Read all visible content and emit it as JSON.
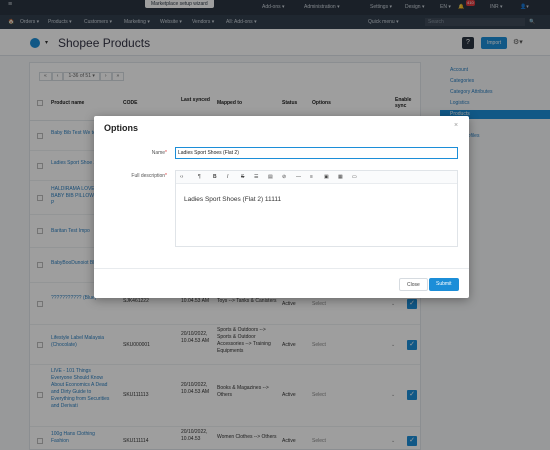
{
  "topbar": {
    "wizard": "Marketplace setup wizard",
    "items": [
      "Add-ons ▾",
      "Administration ▾",
      "Settings ▾",
      "Design ▾",
      "EN ▾",
      "INR ▾"
    ],
    "badge": "410"
  },
  "navbar": {
    "items": [
      "Orders ▾",
      "Products ▾",
      "Customers ▾",
      "Marketing ▾",
      "Website ▾",
      "Vendors ▾",
      "All: Add-ons ▾"
    ],
    "quick_menu": "Quick menu ▾",
    "search_placeholder": "Search"
  },
  "page": {
    "title": "Shopee Products",
    "import_label": "Import"
  },
  "pager": {
    "first": "«",
    "prev": "‹",
    "range": "1-36 of 51 ▾",
    "next": "›",
    "last": "»"
  },
  "table": {
    "headers": {
      "name": "Product name",
      "code": "CODE",
      "last_synced": "Last synced",
      "mapped_to": "Mapped to",
      "status": "Status",
      "options": "Options",
      "enable_sync": "Enable sync"
    },
    "rows": [
      {
        "name": "Baby Bib Test We test",
        "code": "",
        "last": "",
        "mapped": "",
        "status": "",
        "select": ""
      },
      {
        "name": "Ladies Sport Shoe 2)",
        "code": "",
        "last": "",
        "mapped": "",
        "status": "",
        "select": ""
      },
      {
        "name": "HALDIRAMA LOVE SHAPE BABY BIB PILLOW (BABY) P",
        "code": "",
        "last": "",
        "mapped": "",
        "status": "",
        "select": ""
      },
      {
        "name": "Baritan Test Impo",
        "code": "",
        "last": "",
        "mapped": "",
        "status": "",
        "select": ""
      },
      {
        "name": "BabyBooDunoiot Blue)",
        "code": "",
        "last": "",
        "mapped": "",
        "status": "",
        "select": ""
      },
      {
        "name": "??????????? (Blue)",
        "code": "SJK461222",
        "last": "10.04.53 AM",
        "mapped": "Toys --> Tanks & Canisters",
        "status": "Active",
        "select": "Select"
      },
      {
        "name": "Lifestyle Label Malaysia (Chocolate)",
        "code": "SKU000001",
        "last": "20/10/2022, 10.04.53 AM",
        "mapped": "Sports & Outdoors --> Sports & Outdoor Accessories --> Training Equipments",
        "status": "Active",
        "select": "Select"
      },
      {
        "name": "LIVE - 101 Things Everyone Should Know About Economics A Dead and Dirty Guide to Everything from Securities and Derivati",
        "code": "SKU111113",
        "last": "20/10/2022, 10.04.53 AM",
        "mapped": "Books & Magazines --> Others",
        "status": "Active",
        "select": "Select"
      },
      {
        "name": "100g Hans Clothing Fashion",
        "code": "SKU111114",
        "last": "20/10/2022, 10.04.53",
        "mapped": "Women Clothes --> Others",
        "status": "Active",
        "select": "Select"
      }
    ]
  },
  "sidebar": {
    "items": [
      "Account",
      "Categories",
      "Category Attributes",
      "Logistics",
      "Products",
      "Orders",
      "Price Profiles"
    ],
    "active_index": 4
  },
  "modal": {
    "title": "Options",
    "name_label": "Name",
    "name_value": "Ladies Sport Shoes (Flat 2)",
    "desc_label": "Full description",
    "editor_text": "Ladies Sport Shoes (Flat 2) 11111",
    "close_label": "Close",
    "submit_label": "Submit",
    "toolbar": [
      "‹›",
      "¶",
      "B",
      "I",
      "S",
      "☰",
      "▤",
      "⊘",
      "—",
      "≡",
      "▣",
      "▦",
      "▭"
    ]
  },
  "colors": {
    "accent": "#1c8ed8",
    "topbar": "#2a3542",
    "badge": "#e0393e"
  }
}
